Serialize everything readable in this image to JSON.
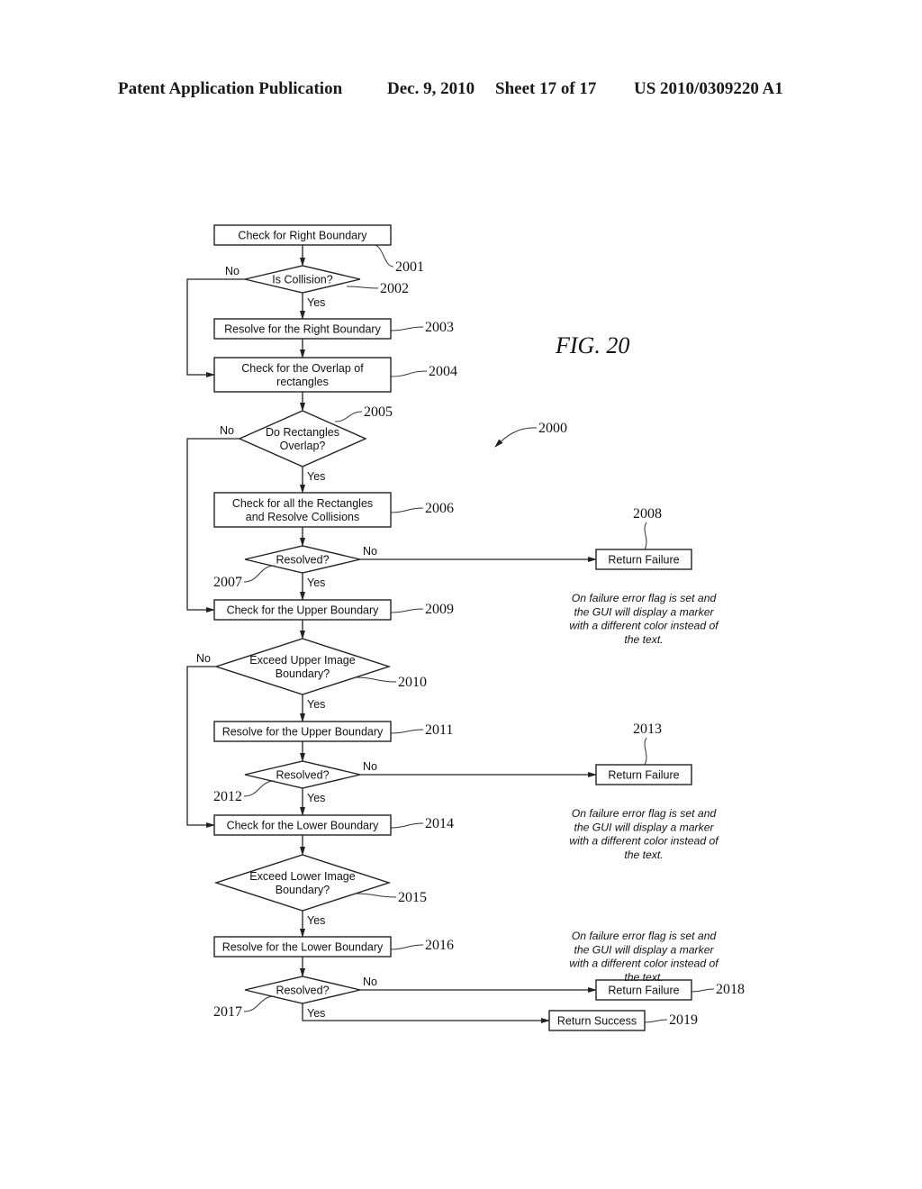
{
  "header": {
    "publication": "Patent Application Publication",
    "date": "Dec. 9, 2010",
    "sheet": "Sheet 17 of 17",
    "number": "US 2010/0309220 A1"
  },
  "figure": {
    "label": "FIG.  20",
    "overall_ref": "2000"
  },
  "nodes": {
    "n2001": {
      "type": "process",
      "lines": [
        "Check for Right Boundary"
      ],
      "ref": "2001"
    },
    "n2002": {
      "type": "decision",
      "lines": [
        "Is Collision?"
      ],
      "ref": "2002"
    },
    "n2003": {
      "type": "process",
      "lines": [
        "Resolve for the Right Boundary"
      ],
      "ref": "2003"
    },
    "n2004": {
      "type": "process",
      "lines": [
        "Check for the Overlap of",
        "rectangles"
      ],
      "ref": "2004"
    },
    "n2005": {
      "type": "decision",
      "lines": [
        "Do Rectangles",
        "Overlap?"
      ],
      "ref": "2005"
    },
    "n2006": {
      "type": "process",
      "lines": [
        "Check for all the Rectangles",
        "and Resolve Collisions"
      ],
      "ref": "2006"
    },
    "n2007": {
      "type": "decision",
      "lines": [
        "Resolved?"
      ],
      "ref": "2007"
    },
    "n2008": {
      "type": "terminal",
      "lines": [
        "Return Failure"
      ],
      "ref": "2008"
    },
    "n2009": {
      "type": "process",
      "lines": [
        "Check for the Upper Boundary"
      ],
      "ref": "2009"
    },
    "n2010": {
      "type": "decision",
      "lines": [
        "Exceed Upper Image",
        "Boundary?"
      ],
      "ref": "2010"
    },
    "n2011": {
      "type": "process",
      "lines": [
        "Resolve for the Upper Boundary"
      ],
      "ref": "2011"
    },
    "n2012": {
      "type": "decision",
      "lines": [
        "Resolved?"
      ],
      "ref": "2012"
    },
    "n2013": {
      "type": "terminal",
      "lines": [
        "Return Failure"
      ],
      "ref": "2013"
    },
    "n2014": {
      "type": "process",
      "lines": [
        "Check for the Lower Boundary"
      ],
      "ref": "2014"
    },
    "n2015": {
      "type": "decision",
      "lines": [
        "Exceed Lower Image",
        "Boundary?"
      ],
      "ref": "2015"
    },
    "n2016": {
      "type": "process",
      "lines": [
        "Resolve for the Lower Boundary"
      ],
      "ref": "2016"
    },
    "n2017": {
      "type": "decision",
      "lines": [
        "Resolved?"
      ],
      "ref": "2017"
    },
    "n2018": {
      "type": "terminal",
      "lines": [
        "Return Failure"
      ],
      "ref": "2018"
    },
    "n2019": {
      "type": "terminal",
      "lines": [
        "Return Success"
      ],
      "ref": "2019"
    }
  },
  "edges": [
    {
      "from": "n2001",
      "to": "n2002",
      "label": ""
    },
    {
      "from": "n2002",
      "to": "n2003",
      "label": "Yes"
    },
    {
      "from": "n2002",
      "to": "n2004",
      "label": "No"
    },
    {
      "from": "n2003",
      "to": "n2004",
      "label": ""
    },
    {
      "from": "n2004",
      "to": "n2005",
      "label": ""
    },
    {
      "from": "n2005",
      "to": "n2006",
      "label": "Yes"
    },
    {
      "from": "n2005",
      "to": "n2009",
      "label": "No"
    },
    {
      "from": "n2006",
      "to": "n2007",
      "label": ""
    },
    {
      "from": "n2007",
      "to": "n2009",
      "label": "Yes"
    },
    {
      "from": "n2007",
      "to": "n2008",
      "label": "No"
    },
    {
      "from": "n2009",
      "to": "n2010",
      "label": ""
    },
    {
      "from": "n2010",
      "to": "n2011",
      "label": "Yes"
    },
    {
      "from": "n2010",
      "to": "n2014",
      "label": "No"
    },
    {
      "from": "n2011",
      "to": "n2012",
      "label": ""
    },
    {
      "from": "n2012",
      "to": "n2014",
      "label": "Yes"
    },
    {
      "from": "n2012",
      "to": "n2013",
      "label": "No"
    },
    {
      "from": "n2014",
      "to": "n2015",
      "label": ""
    },
    {
      "from": "n2015",
      "to": "n2016",
      "label": "Yes"
    },
    {
      "from": "n2016",
      "to": "n2017",
      "label": ""
    },
    {
      "from": "n2017",
      "to": "n2018",
      "label": "No"
    },
    {
      "from": "n2017",
      "to": "n2019",
      "label": "Yes"
    }
  ],
  "notes": {
    "failure_note_lines": [
      "On failure error flag is set and",
      "the GUI will display a marker",
      "with a different color instead of",
      "the text."
    ]
  },
  "labels": {
    "yes": "Yes",
    "no": "No"
  }
}
